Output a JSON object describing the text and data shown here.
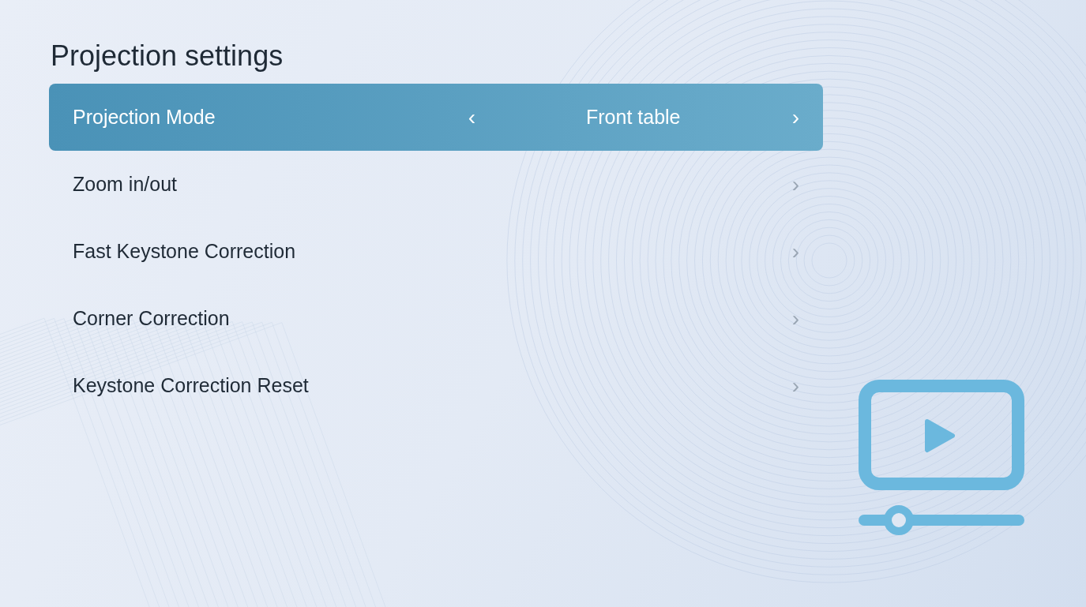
{
  "title": "Projection settings",
  "items": [
    {
      "label": "Projection Mode",
      "selected": true,
      "value": "Front table",
      "prev": "‹",
      "next": "›"
    },
    {
      "label": "Zoom in/out",
      "selected": false,
      "next": "›"
    },
    {
      "label": "Fast Keystone Correction",
      "selected": false,
      "next": "›"
    },
    {
      "label": "Corner Correction",
      "selected": false,
      "next": "›"
    },
    {
      "label": "Keystone Correction Reset",
      "selected": false,
      "next": "›"
    }
  ]
}
